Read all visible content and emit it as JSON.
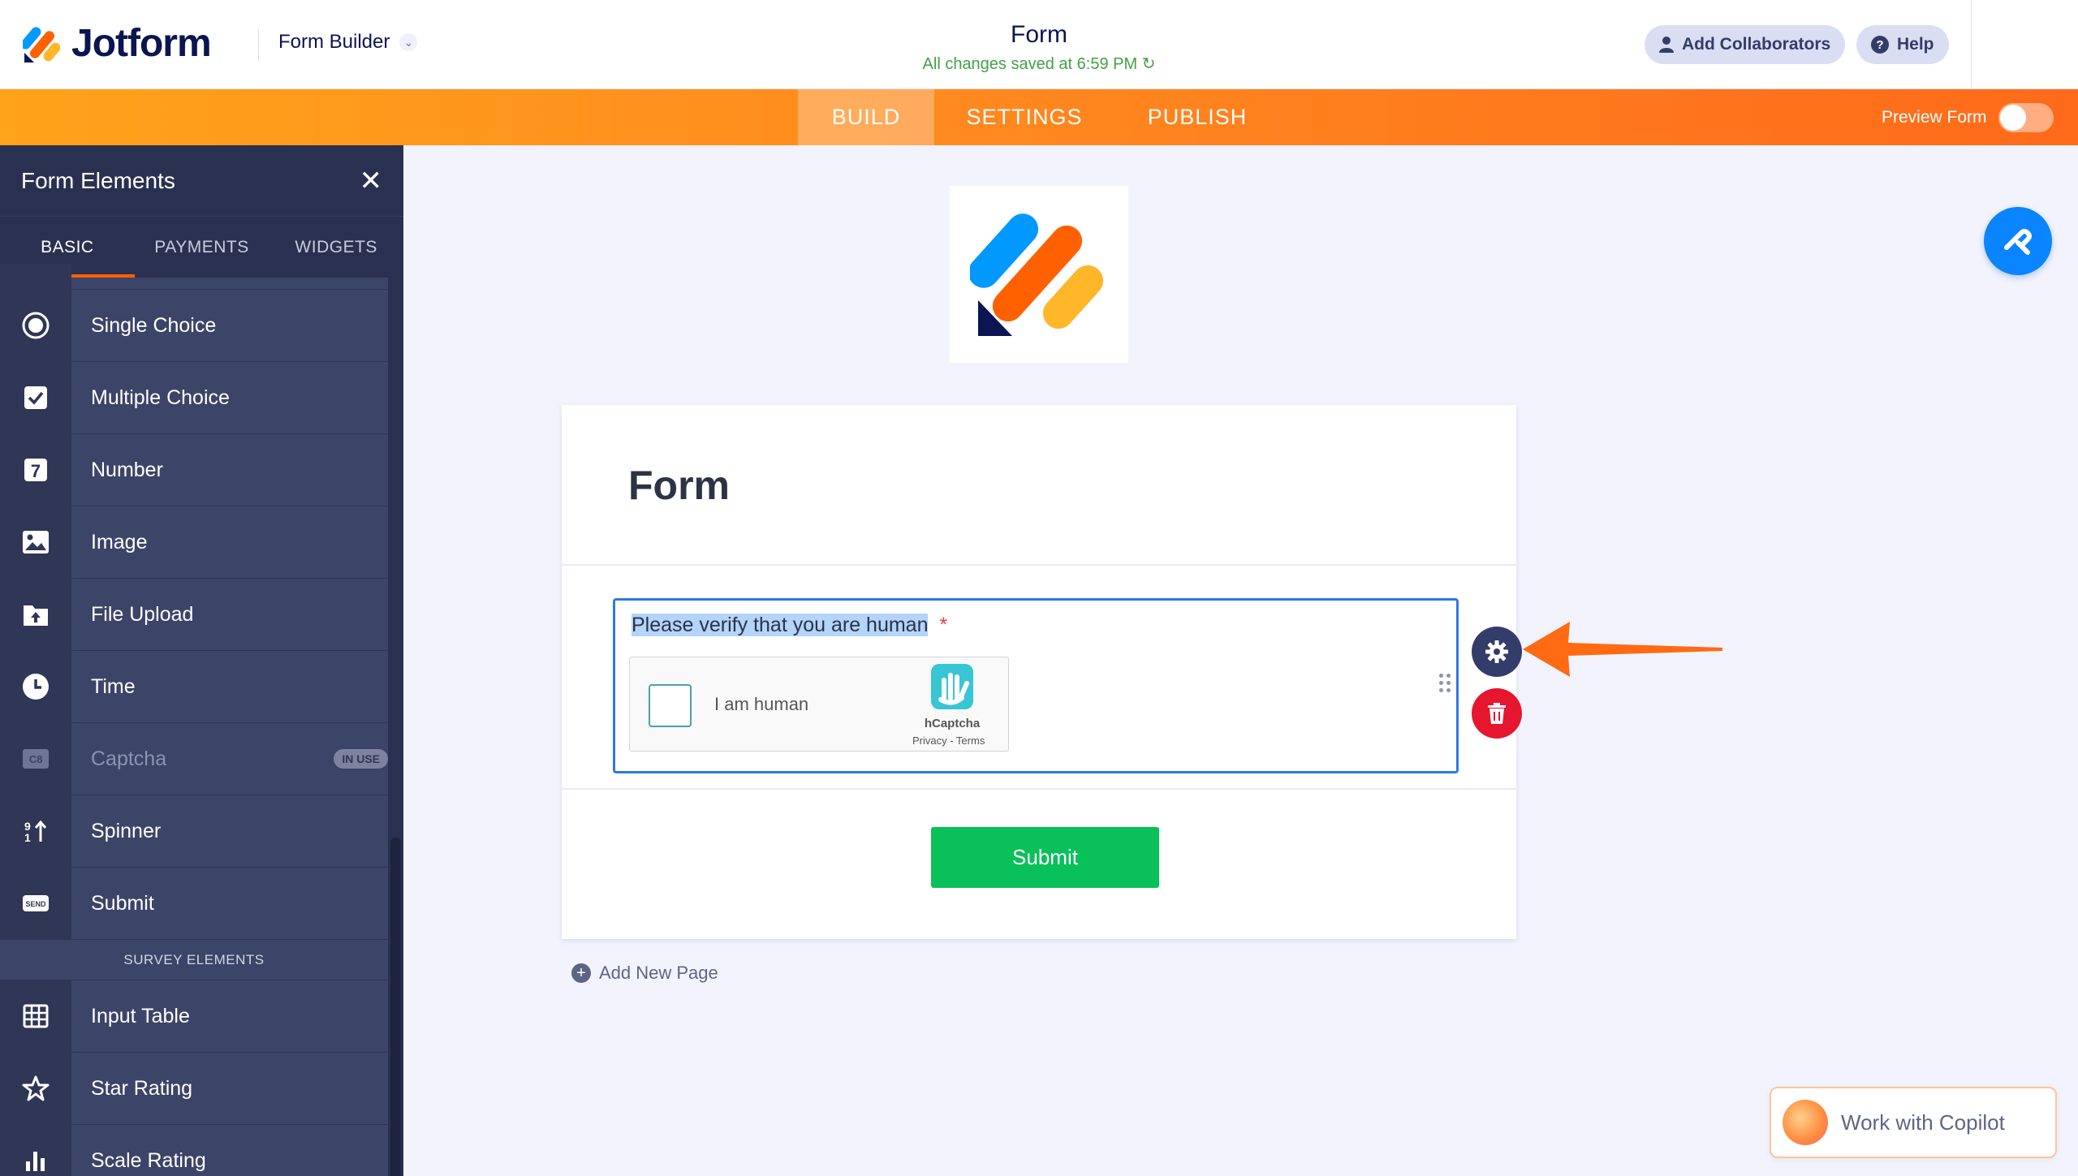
{
  "header": {
    "brand": "Jotform",
    "builder_label": "Form Builder",
    "form_title": "Form",
    "save_status": "All changes saved at 6:59 PM",
    "add_collaborators": "Add Collaborators",
    "help": "Help"
  },
  "nav": {
    "tabs": [
      {
        "label": "BUILD",
        "active": true
      },
      {
        "label": "SETTINGS",
        "active": false
      },
      {
        "label": "PUBLISH",
        "active": false
      }
    ],
    "preview_label": "Preview Form",
    "preview_on": false
  },
  "sidebar": {
    "title": "Form Elements",
    "tabs": [
      "BASIC",
      "PAYMENTS",
      "WIDGETS"
    ],
    "items": [
      {
        "label": "Single Choice",
        "icon": "radio-icon"
      },
      {
        "label": "Multiple Choice",
        "icon": "checkbox-icon"
      },
      {
        "label": "Number",
        "icon": "number-icon"
      },
      {
        "label": "Image",
        "icon": "image-icon"
      },
      {
        "label": "File Upload",
        "icon": "upload-icon"
      },
      {
        "label": "Time",
        "icon": "clock-icon"
      },
      {
        "label": "Captcha",
        "icon": "captcha-icon",
        "badge": "IN USE",
        "disabled": true
      },
      {
        "label": "Spinner",
        "icon": "spinner-icon"
      },
      {
        "label": "Submit",
        "icon": "send-icon"
      }
    ],
    "section_label": "SURVEY ELEMENTS",
    "survey_items": [
      {
        "label": "Input Table",
        "icon": "table-icon"
      },
      {
        "label": "Star Rating",
        "icon": "star-icon"
      },
      {
        "label": "Scale Rating",
        "icon": "bar-chart-icon"
      }
    ]
  },
  "form": {
    "heading": "Form",
    "question": "Please verify that you are human",
    "required_mark": "*",
    "captcha": {
      "checkbox_text": "I am human",
      "brand": "hCaptcha",
      "links": "Privacy - Terms"
    },
    "submit_label": "Submit",
    "add_page": "Add New Page"
  },
  "copilot": {
    "label": "Work with Copilot"
  },
  "colors": {
    "accent_orange": "#ff6100",
    "submit_green": "#09c05a",
    "field_focus": "#2f78e9",
    "delete_red": "#e6162e"
  }
}
